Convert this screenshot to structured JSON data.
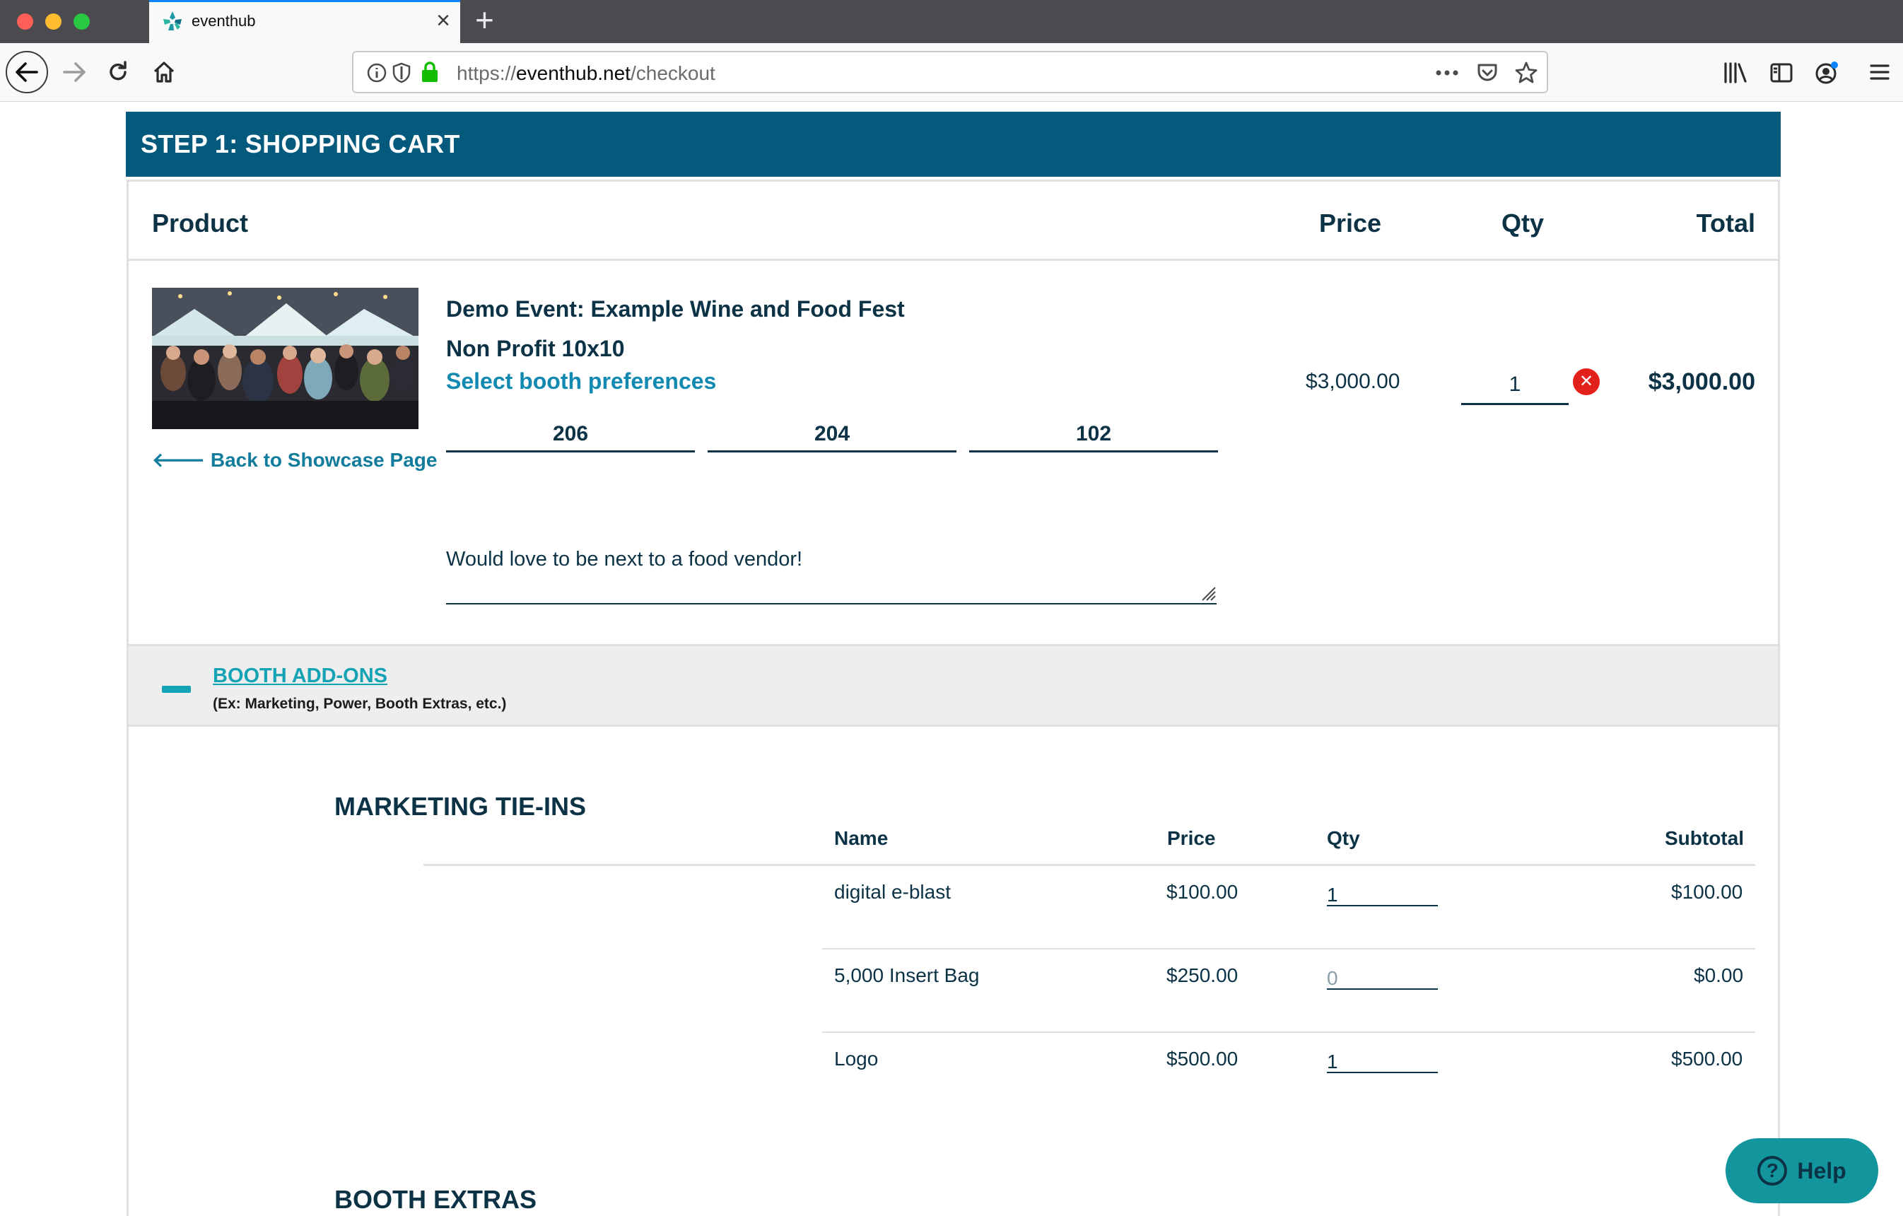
{
  "browser": {
    "tab_title": "eventhub",
    "url_prefix": "https://",
    "url_host": "eventhub.net",
    "url_path": "/checkout",
    "new_tab_symbol": "+",
    "close_symbol": "×"
  },
  "step": {
    "title": "STEP 1: SHOPPING CART"
  },
  "cart": {
    "headers": {
      "product": "Product",
      "price": "Price",
      "qty": "Qty",
      "total": "Total"
    },
    "item": {
      "event_name": "Demo Event: Example Wine and Food Fest",
      "booth_type": "Non Profit 10x10",
      "preferences_link": "Select booth preferences",
      "booth_prefs": [
        "206",
        "204",
        "102"
      ],
      "notes": "Would love to be next to a food vendor!",
      "price": "$3,000.00",
      "qty": "1",
      "total": "$3,000.00",
      "back_link": "Back to Showcase Page"
    }
  },
  "addons": {
    "title": "BOOTH ADD-ONS",
    "subtitle": "(Ex: Marketing, Power, Booth Extras, etc.)",
    "marketing": {
      "title": "MARKETING TIE-INS",
      "headers": {
        "name": "Name",
        "price": "Price",
        "qty": "Qty",
        "subtotal": "Subtotal"
      },
      "rows": [
        {
          "name": "digital e-blast",
          "price": "$100.00",
          "qty": "1",
          "subtotal": "$100.00"
        },
        {
          "name": "5,000 Insert Bag",
          "price": "$250.00",
          "qty": "0",
          "subtotal": "$0.00"
        },
        {
          "name": "Logo",
          "price": "$500.00",
          "qty": "1",
          "subtotal": "$500.00"
        }
      ]
    },
    "extras": {
      "title": "BOOTH EXTRAS"
    }
  },
  "help": {
    "label": "Help"
  },
  "colors": {
    "header_bg": "#045a7c",
    "link": "#1189b0",
    "accent": "#14a3b5",
    "remove": "#e2211c",
    "help_bg": "#13959e"
  }
}
